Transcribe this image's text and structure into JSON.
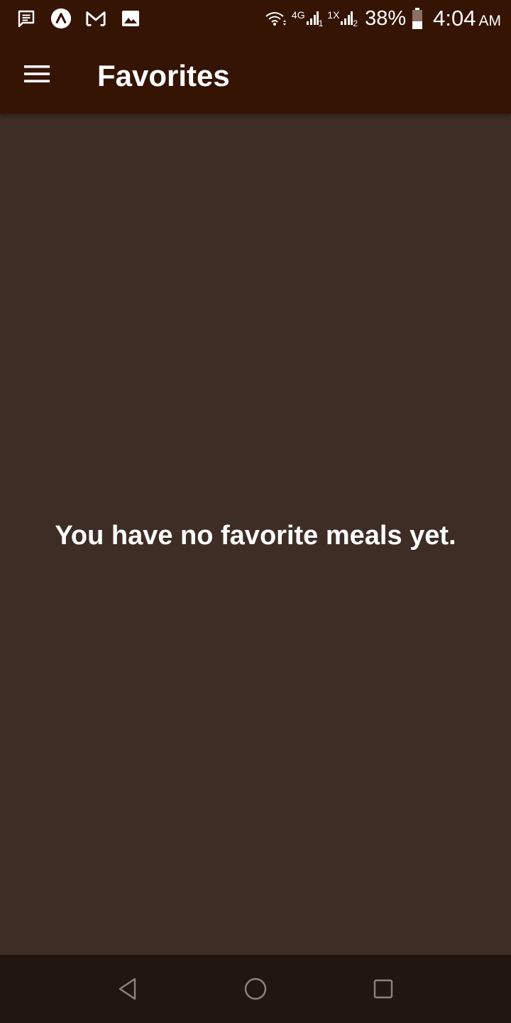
{
  "status_bar": {
    "notification_icons": [
      "message-icon",
      "arc-app-icon",
      "gmail-icon",
      "gallery-icon"
    ],
    "wifi_icon": "wifi-icon",
    "sim1_network": "4G",
    "sim1_index": "1",
    "sim2_network": "1X",
    "sim2_index": "2",
    "battery_percent": "38%",
    "battery_icon": "battery-icon",
    "time": "4:04",
    "ampm": "AM"
  },
  "app_bar": {
    "menu_icon": "hamburger-menu-icon",
    "title": "Favorites"
  },
  "main": {
    "empty_message": "You have no favorite meals yet."
  },
  "nav_bar": {
    "back_icon": "back-triangle-icon",
    "home_icon": "home-circle-icon",
    "recents_icon": "recents-square-icon"
  },
  "colors": {
    "app_bar_bg": "#351404",
    "content_bg": "#3e2d25",
    "nav_bar_bg": "#221610",
    "text": "#ffffff",
    "nav_icon": "#8c8480"
  }
}
